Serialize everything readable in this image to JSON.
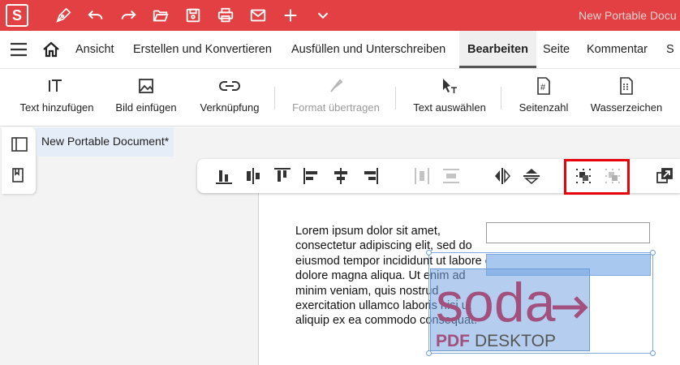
{
  "app": {
    "logo_letter": "S",
    "window_title": "New Portable Docu"
  },
  "quick_access": [
    {
      "name": "pen-icon"
    },
    {
      "name": "undo-icon"
    },
    {
      "name": "redo-icon"
    },
    {
      "name": "open-folder-icon"
    },
    {
      "name": "save-icon"
    },
    {
      "name": "print-icon"
    },
    {
      "name": "mail-icon"
    },
    {
      "name": "plus-icon"
    },
    {
      "name": "chevron-down-icon"
    }
  ],
  "menu": {
    "tabs": [
      {
        "label": "Ansicht"
      },
      {
        "label": "Erstellen und Konvertieren"
      },
      {
        "label": "Ausfüllen und Unterschreiben"
      },
      {
        "label": "Bearbeiten",
        "active": true
      },
      {
        "label": "Seite"
      },
      {
        "label": "Kommentar"
      },
      {
        "label": "S"
      }
    ]
  },
  "ribbon": {
    "buttons": [
      {
        "label": "Text hinzufügen",
        "icon": "add-text-icon"
      },
      {
        "label": "Bild einfügen",
        "icon": "image-icon"
      },
      {
        "label": "Verknüpfung",
        "icon": "link-icon"
      },
      {
        "label": "Format übertragen",
        "icon": "format-painter-icon",
        "disabled": true
      },
      {
        "label": "Text auswählen",
        "icon": "select-text-icon"
      },
      {
        "label": "Seitenzahl",
        "icon": "page-number-icon"
      },
      {
        "label": "Wasserzeichen",
        "icon": "watermark-icon"
      }
    ]
  },
  "document": {
    "tab_title": "New Portable Document*",
    "body_text": "Lorem ipsum dolor sit amet, consectetur adipiscing elit, sed do eiusmod tempor incididunt ut labore et dolore magna aliqua. Ut enim ad minim veniam, quis nostrud exercitation ullamco laboris nisi ut aliquip ex ea commodo consequat.",
    "logo_text": "soda",
    "logo_subtitle": "PDF DESKTOP"
  },
  "align_toolbar": {
    "icons": [
      "align-bottom-icon",
      "align-vertical-center-icon",
      "align-top-icon",
      "align-left-icon",
      "align-horizontal-center-icon",
      "align-right-icon",
      "distribute-horizontal-icon",
      "distribute-vertical-icon",
      "flip-horizontal-icon",
      "flip-vertical-icon",
      "group-icon",
      "ungroup-icon",
      "bring-forward-icon"
    ]
  },
  "colors": {
    "titlebar": "#e24042",
    "logo_purple": "#a2507e",
    "selection_blue": "#a9c8ef",
    "highlight_red": "#e8000b"
  }
}
